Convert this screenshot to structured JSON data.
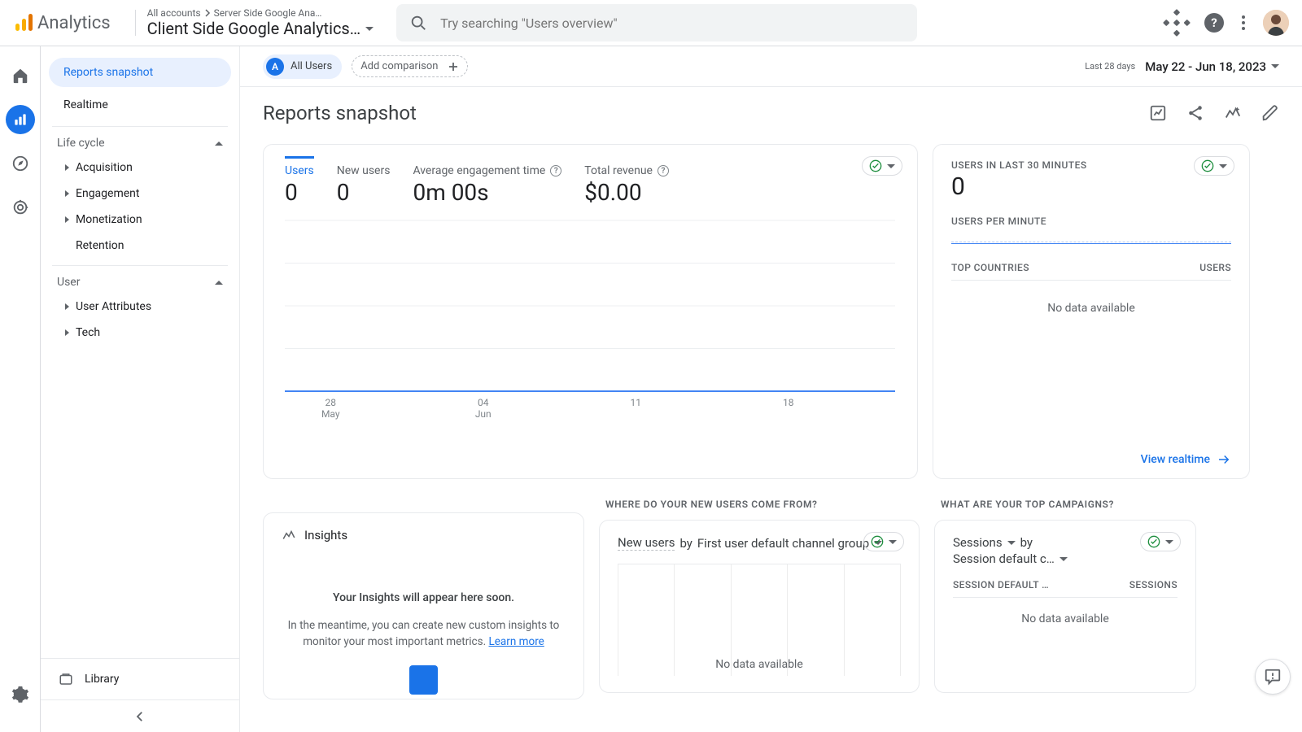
{
  "brand": {
    "name": "Analytics"
  },
  "header": {
    "crumb1": "All accounts",
    "crumb2": "Server Side Google Ana…",
    "property": "Client Side Google Analytics…",
    "search_placeholder": "Try searching \"Users overview\""
  },
  "rail": {
    "home": "home",
    "reports": "reports",
    "explore": "explore",
    "ads": "advertising",
    "settings": "admin"
  },
  "nav": {
    "reports_snapshot": "Reports snapshot",
    "realtime": "Realtime",
    "grp_lifecycle": "Life cycle",
    "lifecycle_items": [
      "Acquisition",
      "Engagement",
      "Monetization",
      "Retention"
    ],
    "grp_user": "User",
    "user_items": [
      "User Attributes",
      "Tech"
    ],
    "library": "Library"
  },
  "toolbar": {
    "all_users": "All Users",
    "add_comparison": "Add comparison",
    "range_label": "Last 28 days",
    "range": "May 22 - Jun 18, 2023"
  },
  "page": {
    "title": "Reports snapshot"
  },
  "metrics": {
    "users": {
      "label": "Users",
      "value": "0"
    },
    "new_users": {
      "label": "New users",
      "value": "0"
    },
    "avg_eng": {
      "label": "Average engagement time",
      "value": "0m 00s"
    },
    "revenue": {
      "label": "Total revenue",
      "value": "$0.00"
    }
  },
  "chart_data": {
    "type": "line",
    "x_ticks": [
      {
        "major": "28",
        "minor": "May"
      },
      {
        "major": "04",
        "minor": "Jun"
      },
      {
        "major": "11",
        "minor": ""
      },
      {
        "major": "18",
        "minor": ""
      }
    ],
    "ylim": [
      0,
      1
    ],
    "series": [
      {
        "name": "Users",
        "values": [
          0,
          0,
          0,
          0,
          0,
          0,
          0,
          0,
          0,
          0,
          0,
          0,
          0,
          0,
          0,
          0,
          0,
          0,
          0,
          0,
          0,
          0,
          0,
          0,
          0,
          0,
          0,
          0
        ],
        "color": "#4285f4"
      }
    ]
  },
  "realtime_card": {
    "title": "USERS IN LAST 30 MINUTES",
    "value": "0",
    "subtitle": "USERS PER MINUTE",
    "col_country": "TOP COUNTRIES",
    "col_users": "USERS",
    "empty": "No data available",
    "link": "View realtime"
  },
  "row2": {
    "insights": {
      "heading": "Insights",
      "line1": "Your Insights will appear here soon.",
      "line2a": "In the meantime, you can create new custom insights to monitor your most important metrics. ",
      "learn": "Learn more"
    },
    "channels": {
      "section_title": "WHERE DO YOUR NEW USERS COME FROM?",
      "prefix": "New users",
      "by": "by",
      "dimension": "First user default channel group",
      "empty": "No data available"
    },
    "campaigns": {
      "section_title": "WHAT ARE YOUR TOP CAMPAIGNS?",
      "metric": "Sessions",
      "by": "by",
      "dimension": "Session default c…",
      "col1": "SESSION DEFAULT …",
      "col2": "SESSIONS",
      "empty": "No data available"
    }
  }
}
